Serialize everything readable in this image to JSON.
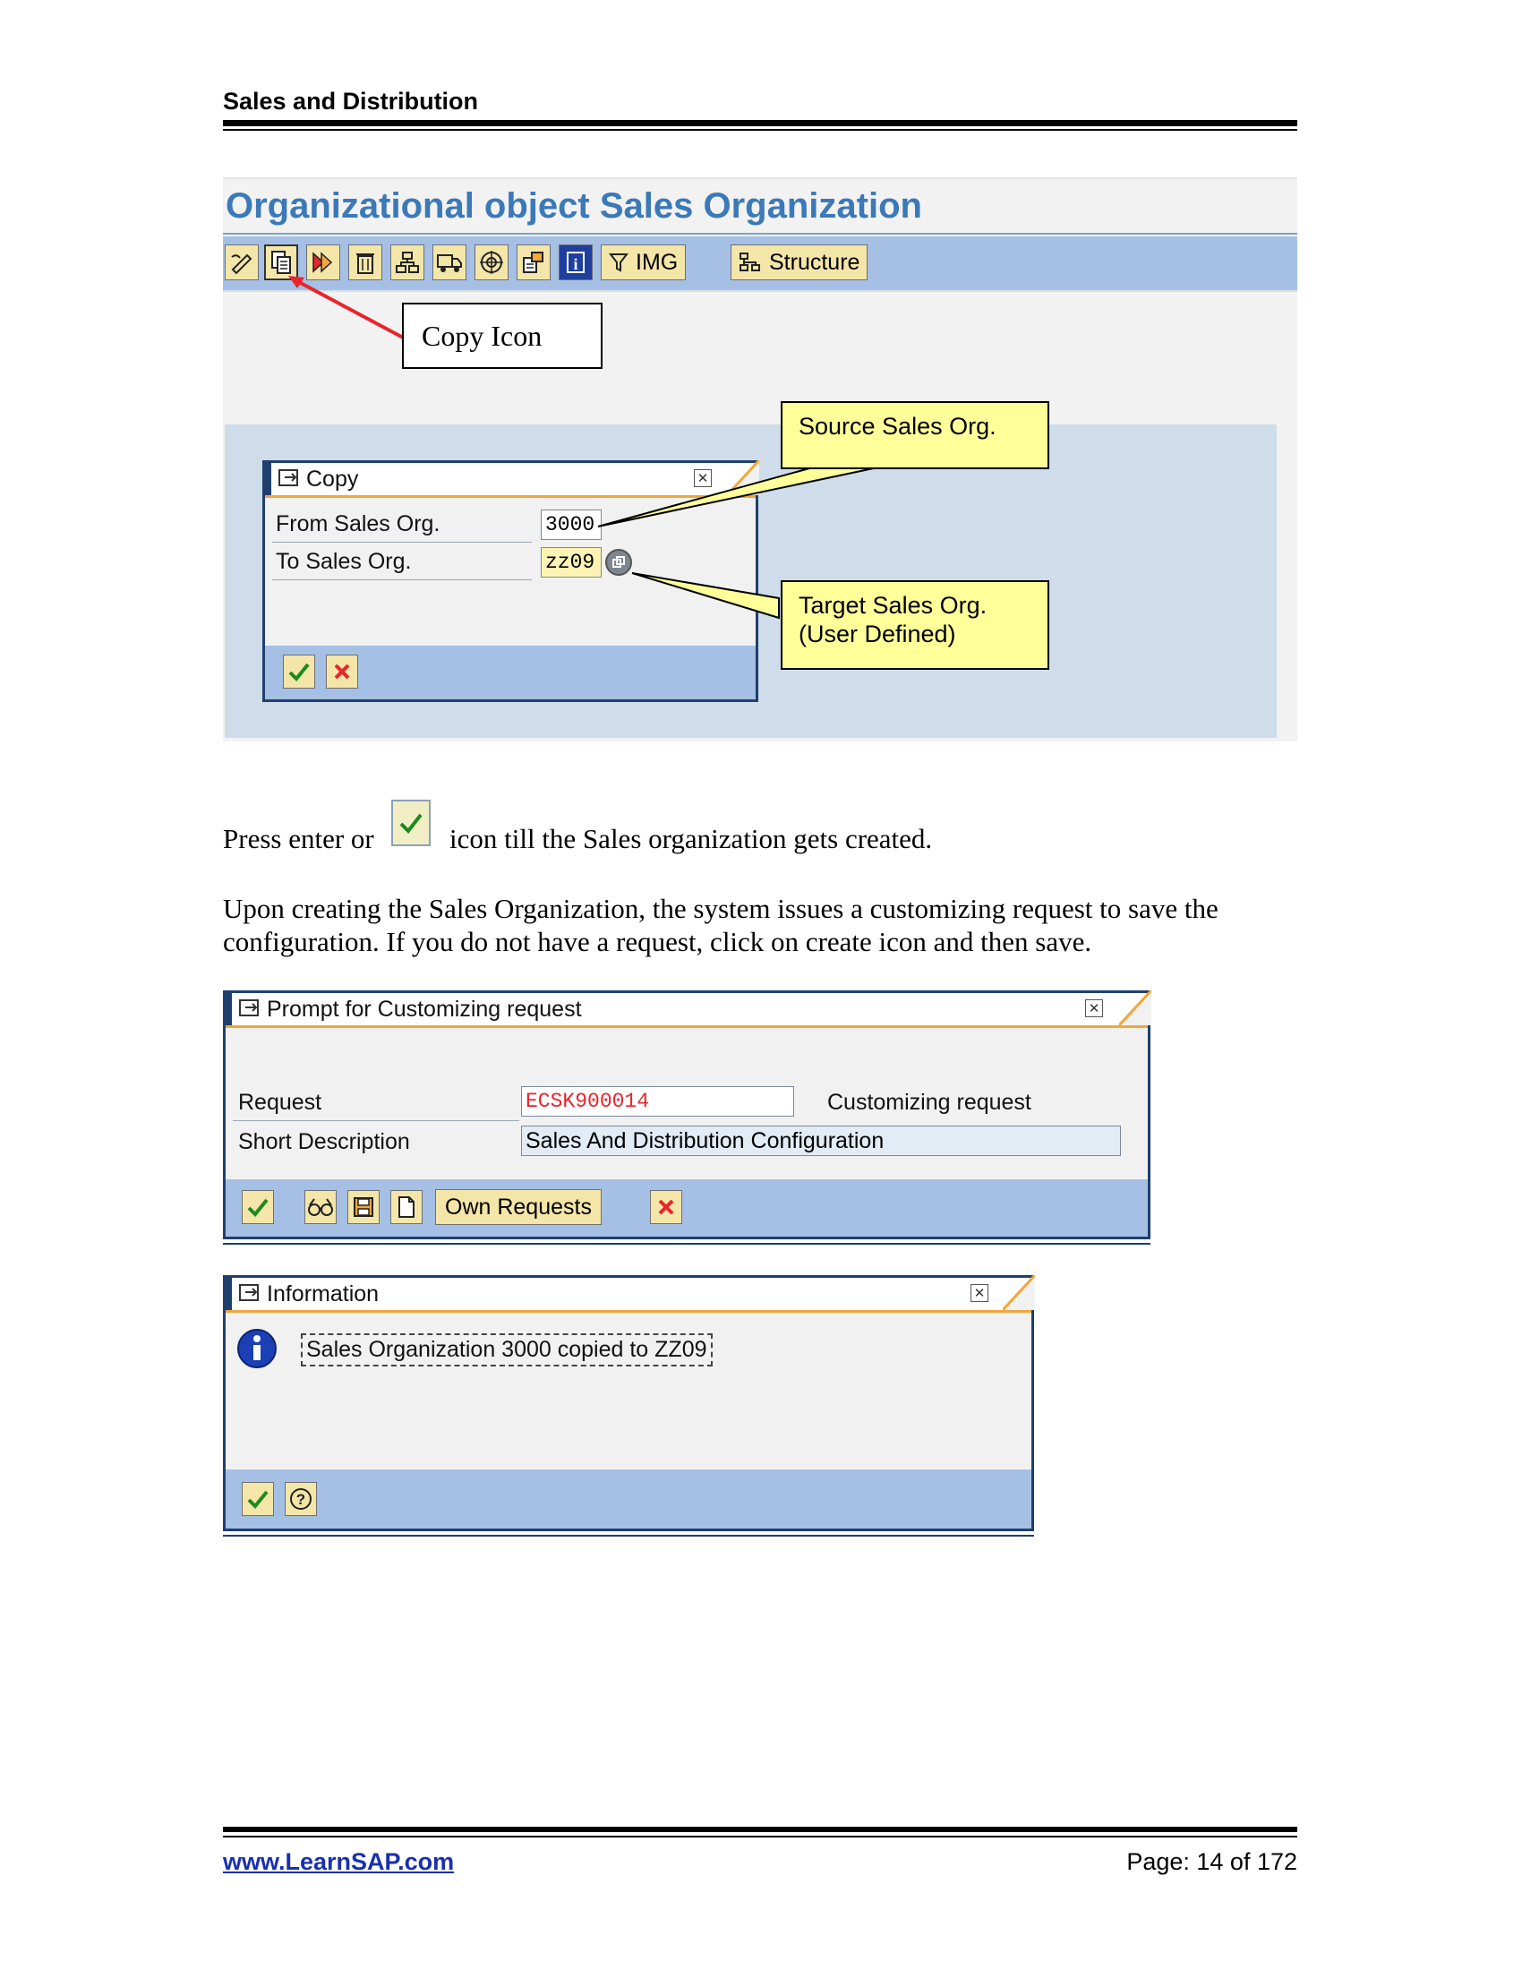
{
  "header": {
    "title": "Sales and Distribution"
  },
  "screen1": {
    "title": "Organizational object Sales Organization",
    "toolbar": {
      "img_label": "IMG",
      "structure_label": "Structure"
    },
    "copy_icon_callout": "Copy Icon",
    "source_callout": "Source Sales Org.",
    "target_callout_line1": "Target Sales Org.",
    "target_callout_line2": "(User Defined)",
    "copy_dialog": {
      "title": "Copy",
      "from_label": "From Sales Org.",
      "from_value": "3000",
      "to_label": "To Sales Org.",
      "to_value": "zz09"
    }
  },
  "para1_before": "Press enter or",
  "para1_after": "icon till the Sales organization gets created.",
  "para2_line1": "Upon creating the Sales Organization, the system issues a customizing request to save the",
  "para2_line2": "configuration. If you do not have a request, click on create icon and then save.",
  "request_dialog": {
    "title": "Prompt for Customizing request",
    "request_label": "Request",
    "request_value": "ECSK900014",
    "request_type": "Customizing request",
    "desc_label": "Short Description",
    "desc_value": "Sales And Distribution Configuration",
    "own_requests_label": "Own Requests"
  },
  "info_dialog": {
    "title": "Information",
    "message": "Sales Organization 3000 copied to ZZ09"
  },
  "footer": {
    "link": "www.LearnSAP.com",
    "page": "Page: 14 of 172"
  },
  "colors": {
    "sap_blue_title": "#3b79b8",
    "toolbar": "#a5c0e4",
    "callout_yellow": "#ffff9a",
    "request_red": "#e8242c",
    "footer_link": "#1a2fb0"
  }
}
